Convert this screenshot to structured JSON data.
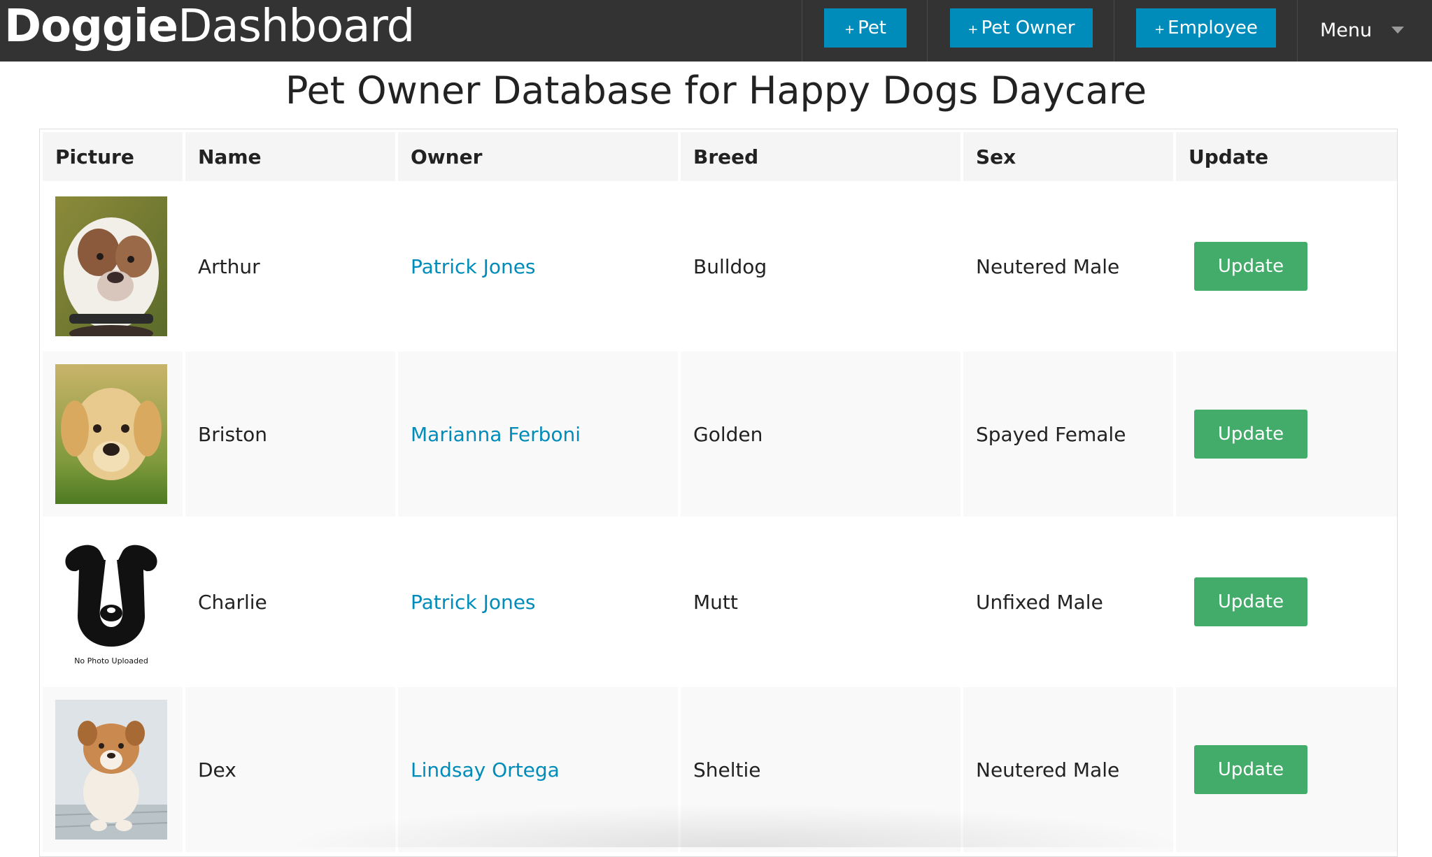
{
  "app": {
    "brand_bold": "Doggie",
    "brand_light": "Dashboard"
  },
  "nav": {
    "add_pet": {
      "plus": "+",
      "label": "Pet"
    },
    "add_owner": {
      "plus": "+",
      "label": "Pet Owner"
    },
    "add_employee": {
      "plus": "+",
      "label": "Employee"
    },
    "menu_label": "Menu"
  },
  "page": {
    "title": "Pet Owner Database for Happy Dogs Daycare"
  },
  "table": {
    "headers": [
      "Picture",
      "Name",
      "Owner",
      "Breed",
      "Sex",
      "Update"
    ],
    "rows": [
      {
        "name": "Arthur",
        "owner": "Patrick Jones",
        "breed": "Bulldog",
        "sex": "Neutered Male",
        "update": "Update",
        "photo_icon": "bulldog-photo"
      },
      {
        "name": "Briston",
        "owner": "Marianna Ferboni",
        "breed": "Golden",
        "sex": "Spayed Female",
        "update": "Update",
        "photo_icon": "golden-puppy-photo"
      },
      {
        "name": "Charlie",
        "owner": "Patrick Jones",
        "breed": "Mutt",
        "sex": "Unfixed Male",
        "update": "Update",
        "photo_icon": "dog-silhouette-icon",
        "photo_caption": "No Photo Uploaded"
      },
      {
        "name": "Dex",
        "owner": "Lindsay Ortega",
        "breed": "Sheltie",
        "sex": "Neutered Male",
        "update": "Update",
        "photo_icon": "sheltie-puppy-photo"
      }
    ]
  },
  "colors": {
    "topbar": "#333333",
    "nav_button": "#008cba",
    "link": "#008cba",
    "update_button": "#43ac6a",
    "header_bg": "#f5f5f5",
    "stripe_bg": "#f9f9f9"
  }
}
